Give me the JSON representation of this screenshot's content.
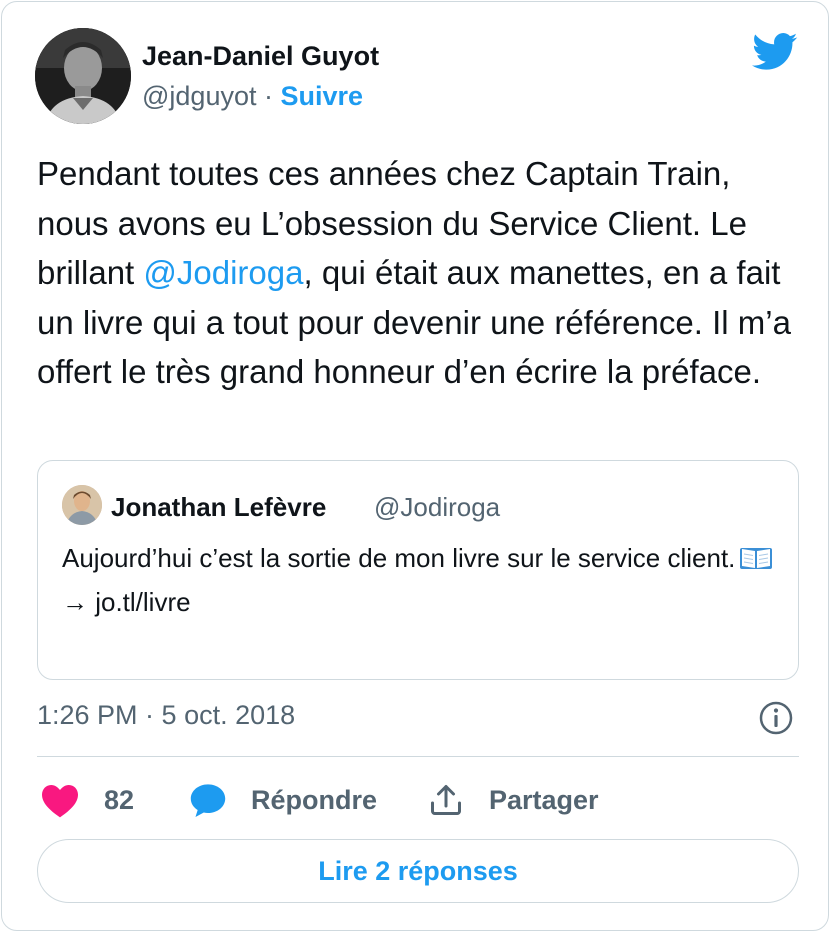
{
  "author": {
    "name": "Jean-Daniel Guyot",
    "handle": "@jdguyot",
    "separator": "·",
    "follow_label": "Suivre"
  },
  "tweet": {
    "text_before_mention": "Pendant toutes ces années chez Captain Train, nous avons eu L’obsession du Service Client. Le brillant ",
    "mention": "@Jodiroga",
    "text_after_mention": ", qui était aux manettes, en a fait un livre qui a tout pour devenir une référence. Il m’a offert le très grand honneur d’en écrire la préface."
  },
  "quoted_tweet": {
    "name": "Jonathan Lefèvre",
    "handle": "@Jodiroga",
    "line1": "Aujourd’hui c’est la sortie de mon livre sur le service client.",
    "line2": "→ jo.tl/livre",
    "emoji_icon": "open-book-icon"
  },
  "meta": {
    "timestamp": "1:26 PM · 5 oct. 2018"
  },
  "actions": {
    "like_count": "82",
    "reply_label": "Répondre",
    "share_label": "Partager"
  },
  "read_replies_label": "Lire 2 réponses",
  "icons": {
    "brand": "twitter-bird-icon",
    "like": "heart-icon",
    "reply": "speech-bubble-icon",
    "share": "share-upload-icon",
    "info": "info-icon"
  },
  "colors": {
    "accent": "#1d9bf0",
    "heart": "#f91880",
    "text": "#0f1419",
    "muted": "#536471",
    "border": "#cfd9de"
  }
}
